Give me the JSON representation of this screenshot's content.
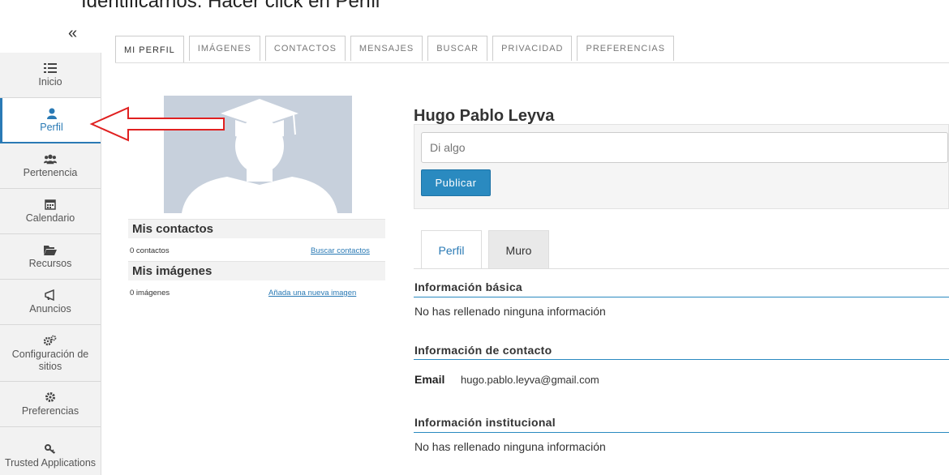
{
  "instruction": "Identificarnos: Hacer click en Perfil",
  "sidebar": {
    "collapse_glyph": "«",
    "items": [
      {
        "label": "Inicio",
        "icon": "list-icon"
      },
      {
        "label": "Perfil",
        "icon": "user-icon"
      },
      {
        "label": "Pertenencia",
        "icon": "group-icon"
      },
      {
        "label": "Calendario",
        "icon": "calendar-icon"
      },
      {
        "label": "Recursos",
        "icon": "folder-open-icon"
      },
      {
        "label": "Anuncios",
        "icon": "bullhorn-icon"
      },
      {
        "label": "Configuración de sitios",
        "icon": "cogs-icon"
      },
      {
        "label": "Preferencias",
        "icon": "gear-icon"
      },
      {
        "label": "Trusted Applications",
        "icon": "key-icon"
      }
    ]
  },
  "tabs": [
    "MI PERFIL",
    "IMÁGENES",
    "CONTACTOS",
    "MENSAJES",
    "BUSCAR",
    "PRIVACIDAD",
    "PREFERENCIAS"
  ],
  "left": {
    "contacts_title": "Mis contactos",
    "contacts_count": "0 contactos",
    "contacts_link": "Buscar contactos",
    "images_title": "Mis imágenes",
    "images_count": "0 imágenes",
    "images_link": "Añada una nueva imagen"
  },
  "profile": {
    "name": "Hugo Pablo Leyva",
    "post_placeholder": "Di algo",
    "publish_label": "Publicar",
    "subtabs": [
      "Perfil",
      "Muro"
    ],
    "basic_title": "Información básica",
    "basic_text": "No has rellenado ninguna información",
    "contact_title": "Información de contacto",
    "email_label": "Email",
    "email_value": "hugo.pablo.leyva@gmail.com",
    "institutional_title": "Información institucional",
    "institutional_text": "No has rellenado ninguna información"
  },
  "colors": {
    "accent": "#2a7ab5",
    "button": "#2a8ac0",
    "arrow": "#e02020"
  }
}
